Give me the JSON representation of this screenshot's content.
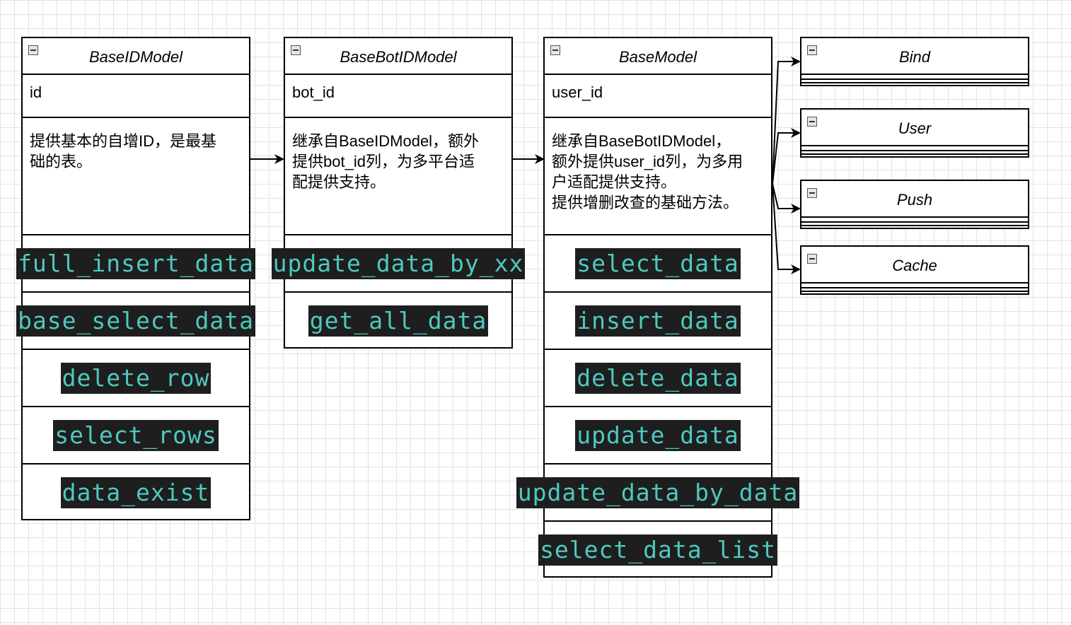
{
  "classes": [
    {
      "name": "BaseIDModel",
      "field": "id",
      "description": "提供基本的自增ID，是最基\n础的表。",
      "methods": [
        "full_insert_data",
        "base_select_data",
        "delete_row",
        "select_rows",
        "data_exist"
      ]
    },
    {
      "name": "BaseBotIDModel",
      "field": "bot_id",
      "description": "继承自BaseIDModel，额外\n提供bot_id列，为多平台适\n配提供支持。",
      "methods": [
        "update_data_by_xx",
        "get_all_data"
      ]
    },
    {
      "name": "BaseModel",
      "field": "user_id",
      "description": "继承自BaseBotIDModel，\n额外提供user_id列，为多用\n户适配提供支持。\n提供增删改查的基础方法。",
      "methods": [
        "select_data",
        "insert_data",
        "delete_data",
        "update_data",
        "update_data_by_data",
        "select_data_list"
      ]
    }
  ],
  "subclasses": [
    "Bind",
    "User",
    "Push",
    "Cache"
  ],
  "colors": {
    "code_bg": "#1e1e1e",
    "code_text": "#4ec9c0",
    "grid": "#e3e3e3",
    "border": "#000000"
  }
}
